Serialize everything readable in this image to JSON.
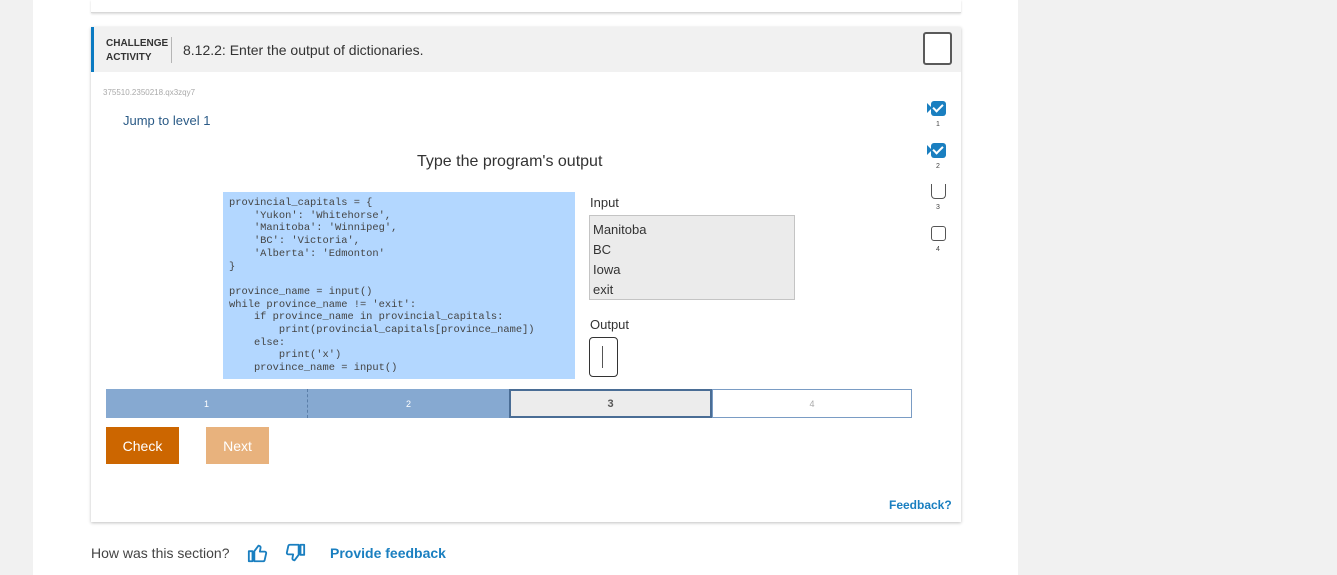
{
  "activity": {
    "type_label_line1": "CHALLENGE",
    "type_label_line2": "ACTIVITY",
    "title": "8.12.2: Enter the output of dictionaries.",
    "id": "375510.2350218.qx3zqy7",
    "jump_label": "Jump to level 1",
    "prompt_title": "Type the program's output"
  },
  "code_lines": [
    "provincial_capitals = {",
    "    'Yukon': 'Whitehorse',",
    "    'Manitoba': 'Winnipeg',",
    "    'BC': 'Victoria',",
    "    'Alberta': 'Edmonton'",
    "}",
    "",
    "province_name = input()",
    "while province_name != 'exit':",
    "    if province_name in provincial_capitals:",
    "        print(provincial_capitals[province_name])",
    "    else:",
    "        print('x')",
    "    province_name = input()"
  ],
  "io": {
    "input_label": "Input",
    "input_lines": [
      "Manitoba",
      "BC",
      "Iowa",
      "exit"
    ],
    "output_label": "Output",
    "output_value": ""
  },
  "levels": [
    {
      "label": "1",
      "state": "completed"
    },
    {
      "label": "2",
      "state": "completed"
    },
    {
      "label": "3",
      "state": "current"
    },
    {
      "label": "4",
      "state": "locked"
    }
  ],
  "buttons": {
    "check": "Check",
    "next": "Next"
  },
  "feedback_link": "Feedback?",
  "progress": [
    {
      "label": "1",
      "state": "done"
    },
    {
      "label": "2",
      "state": "done"
    },
    {
      "label": "3",
      "state": "current"
    },
    {
      "label": "4",
      "state": "open"
    }
  ],
  "footer": {
    "question": "How was this section?",
    "thumbs_up_icon": "thumbs-up-icon",
    "thumbs_down_icon": "thumbs-down-icon",
    "provide_feedback": "Provide feedback"
  },
  "colors": {
    "accent": "#0a7ac2",
    "code_bg": "#b3d7ff",
    "check_button": "#cc6600",
    "next_button": "#e8b27d",
    "level_done": "#86a9d1",
    "link": "#1a7fc0"
  }
}
